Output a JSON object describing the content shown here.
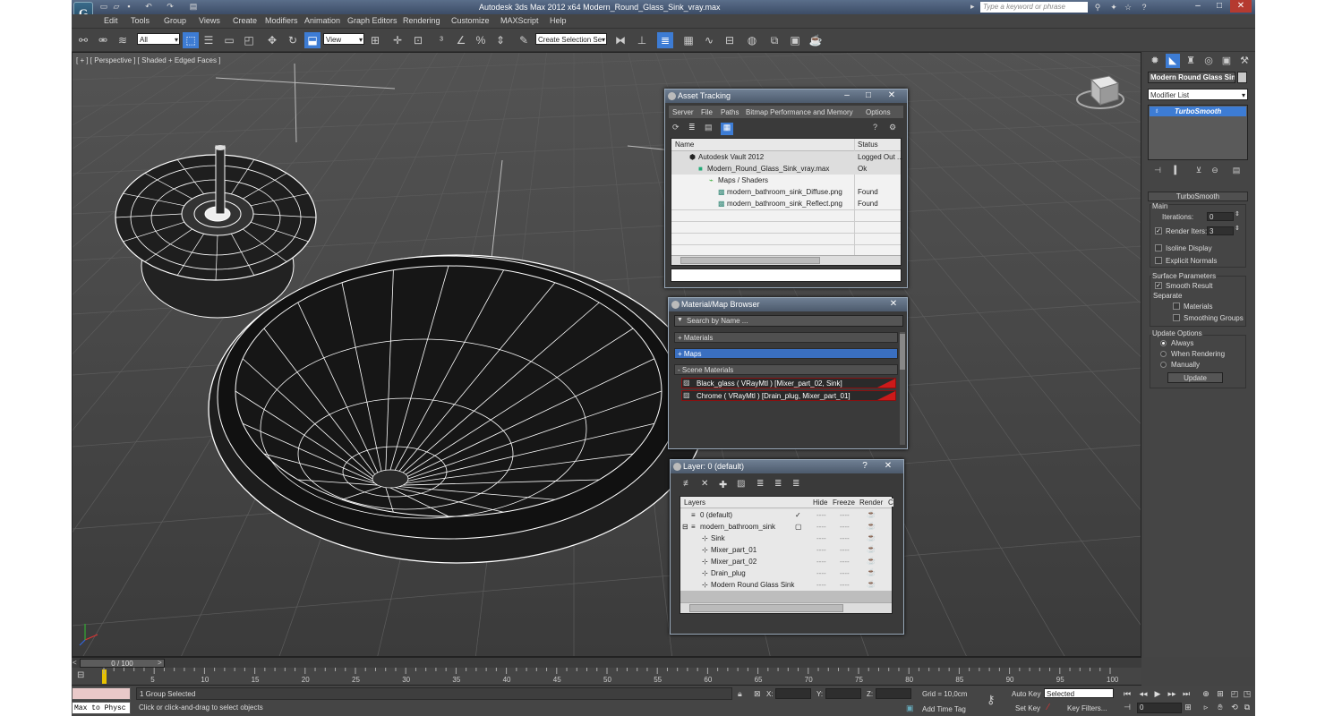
{
  "app": {
    "title": "Autodesk 3ds Max  2012 x64     Modern_Round_Glass_Sink_vray.max",
    "logo": "G",
    "search_placeholder": "Type a keyword or phrase"
  },
  "menus": [
    "Edit",
    "Tools",
    "Group",
    "Views",
    "Create",
    "Modifiers",
    "Animation",
    "Graph Editors",
    "Rendering",
    "Customize",
    "MAXScript",
    "Help"
  ],
  "toolbar": {
    "filter_value": "All",
    "refcoord_value": "View",
    "named_selection_placeholder": "Create Selection Se"
  },
  "viewport": {
    "label": "[ + ] [ Perspective ] [ Shaded + Edged Faces ]"
  },
  "asset_tracking": {
    "title": "Asset Tracking",
    "menu": [
      "Server",
      "File",
      "Paths",
      "Bitmap Performance and Memory",
      "Options"
    ],
    "col_name": "Name",
    "col_status": "Status",
    "rows": [
      {
        "name": "Autodesk Vault 2012",
        "status": "Logged Out ..."
      },
      {
        "name": "Modern_Round_Glass_Sink_vray.max",
        "status": "Ok"
      },
      {
        "name": "Maps / Shaders",
        "status": ""
      },
      {
        "name": "modern_bathroom_sink_Diffuse.png",
        "status": "Found"
      },
      {
        "name": "modern_bathroom_sink_Reflect.png",
        "status": "Found"
      }
    ]
  },
  "material_browser": {
    "title": "Material/Map Browser",
    "search_placeholder": "Search by Name ...",
    "sections": [
      "+ Materials",
      "+ Maps",
      "- Scene Materials"
    ],
    "materials": [
      "Black_glass  ( VRayMtl ) [Mixer_part_02, Sink]",
      "Chrome  ( VRayMtl ) [Drain_plug, Mixer_part_01]"
    ]
  },
  "layer_dialog": {
    "title": "Layer: 0 (default)",
    "help": "?",
    "col_layers": "Layers",
    "col_hide": "Hide",
    "col_freeze": "Freeze",
    "col_render": "Render",
    "col_c": "C",
    "rows": [
      {
        "name": "0 (default)"
      },
      {
        "name": "modern_bathroom_sink"
      },
      {
        "name": "Sink"
      },
      {
        "name": "Mixer_part_01"
      },
      {
        "name": "Mixer_part_02"
      },
      {
        "name": "Drain_plug"
      },
      {
        "name": "Modern Round Glass Sink"
      }
    ],
    "dashes": "----"
  },
  "command_panel": {
    "object_name": "Modern Round Glass Sink",
    "modifier_list": "Modifier List",
    "stack_item": "TurboSmooth",
    "rollout_title": "TurboSmooth",
    "main_label": "Main",
    "iterations_label": "Iterations:",
    "iterations_value": "0",
    "render_iters_label": "Render Iters:",
    "render_iters_value": "3",
    "isoline_label": "Isoline Display",
    "explicit_label": "Explicit Normals",
    "surface_label": "Surface Parameters",
    "smooth_label": "Smooth Result",
    "separate_label": "Separate",
    "materials_label": "Materials",
    "smoothing_groups_label": "Smoothing Groups",
    "update_options_label": "Update Options",
    "always_label": "Always",
    "when_rendering_label": "When Rendering",
    "manually_label": "Manually",
    "update_button": "Update"
  },
  "timeline": {
    "frame_display": "0 / 100",
    "ticks": [
      "5",
      "10",
      "15",
      "20",
      "25",
      "30",
      "35",
      "40",
      "45",
      "50",
      "55",
      "60",
      "65",
      "70",
      "75",
      "80",
      "85",
      "90",
      "95",
      "100"
    ]
  },
  "status": {
    "maxscript": "Max to Physc",
    "selection": "1 Group Selected",
    "prompt": "Click or click-and-drag to select objects",
    "x_label": "X:",
    "y_label": "Y:",
    "z_label": "Z:",
    "grid": "Grid = 10,0cm",
    "add_time_tag": "Add Time Tag",
    "auto_key": "Auto Key",
    "auto_key_value": "Selected",
    "set_key": "Set Key",
    "key_filters": "Key Filters...",
    "frame_value": "0"
  }
}
